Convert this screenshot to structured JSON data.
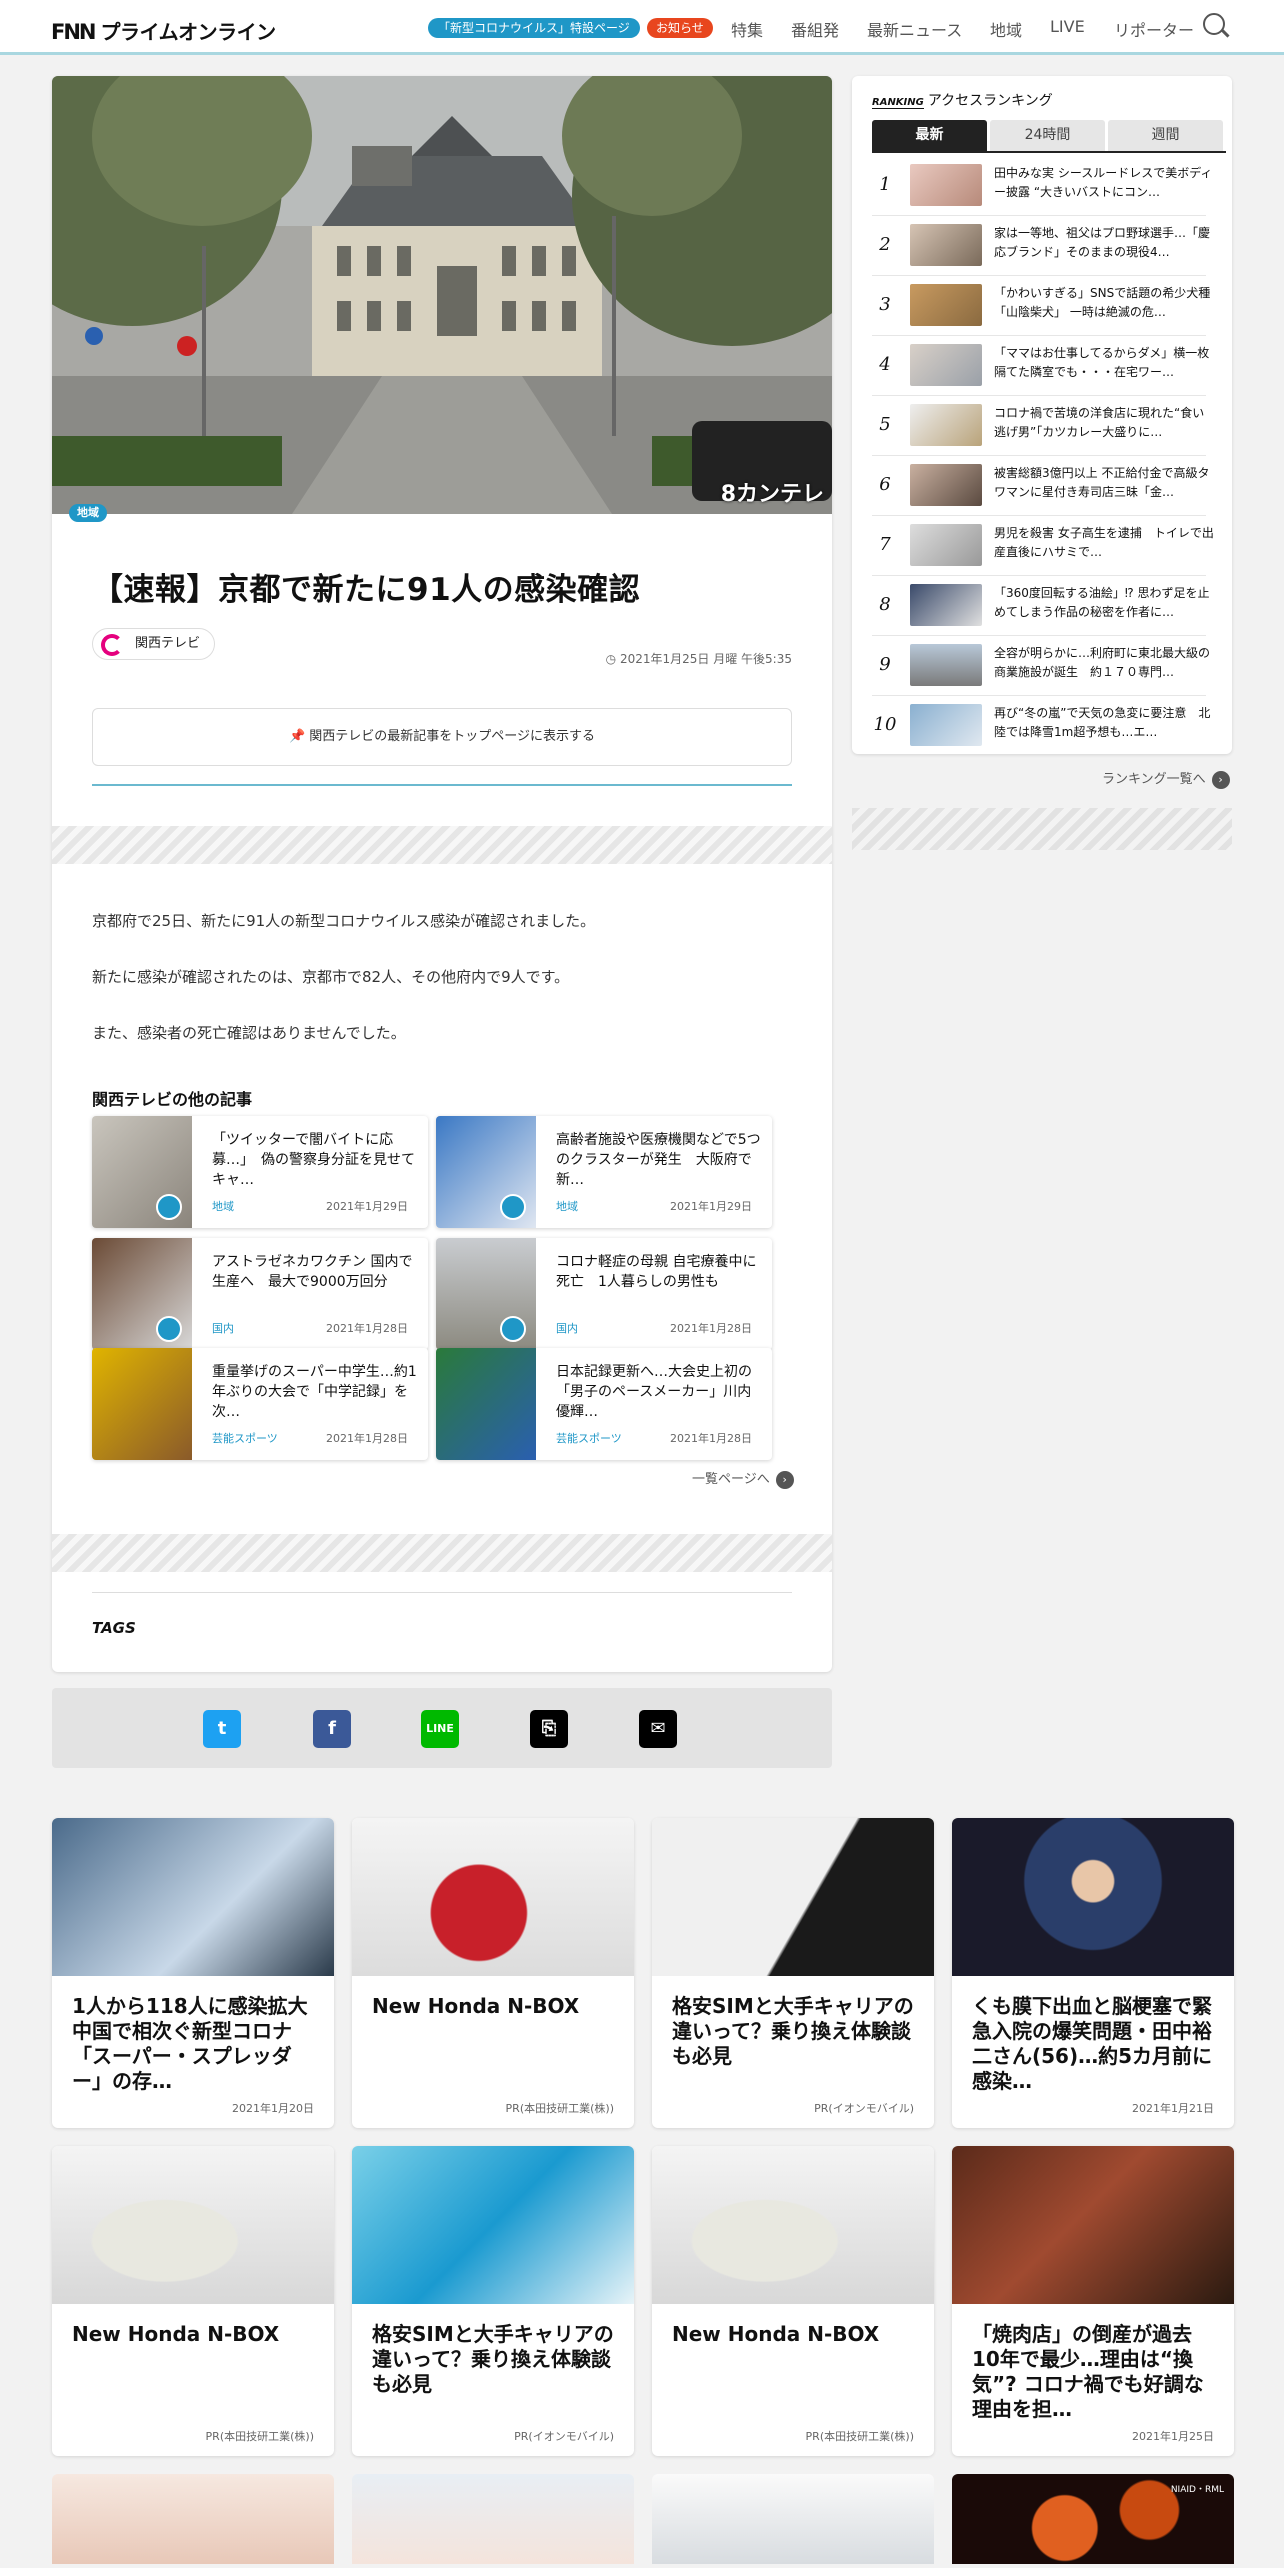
{
  "header": {
    "logo": "FNNプライムオンライン",
    "logo_mark": "FNN",
    "logo_text": "プライムオンライン",
    "covid_pill": "「新型コロナウイルス」特設ページ",
    "notice_pill": "お知らせ",
    "nav": [
      "特集",
      "番組発",
      "最新ニュース",
      "地域",
      "LIVE",
      "リポーター"
    ]
  },
  "article": {
    "region_badge": "地域",
    "title": "【速報】京都で新たに91人の感染確認",
    "source": "関西テレビ",
    "date": "2021年1月25日 月曜 午後5:35",
    "pin_text": "関西テレビの最新記事をトップページに表示する",
    "body": [
      "京都府で25日、新たに91人の新型コロナウイルス感染が確認されました。",
      "新たに感染が確認されたのは、京都市で82人、その他府内で9人です。",
      "また、感染者の死亡確認はありませんでした。"
    ],
    "other_heading": "関西テレビの他の記事",
    "other": [
      {
        "title": "「ツイッターで闇バイトに応募…」　偽の警察身分証を見せてキャ…",
        "cat": "地域",
        "date": "2021年1月29日"
      },
      {
        "title": "高齢者施設や医療機関などで5つのクラスターが発生　大阪府で新…",
        "cat": "地域",
        "date": "2021年1月29日"
      },
      {
        "title": "アストラゼネカワクチン 国内で生産へ　最大で9000万回分",
        "cat": "国内",
        "date": "2021年1月28日"
      },
      {
        "title": "コロナ軽症の母親 自宅療養中に死亡　1人暮らしの男性も",
        "cat": "国内",
        "date": "2021年1月28日"
      },
      {
        "title": "重量挙げのスーパー中学生…約1年ぶりの大会で「中学記録」を次…",
        "cat": "芸能スポーツ",
        "date": "2021年1月28日"
      },
      {
        "title": "日本記録更新へ…大会史上初の「男子のペースメーカー」川内優輝…",
        "cat": "芸能スポーツ",
        "date": "2021年1月28日"
      }
    ],
    "more_link": "一覧ページへ",
    "tags_label": "TAGS",
    "overlay_logo": "8カンテレ"
  },
  "share": {
    "icons": [
      "twitter-icon",
      "facebook-icon",
      "line-icon",
      "link-icon",
      "comment-icon"
    ]
  },
  "ranking": {
    "label_small": "RANKING",
    "label": "アクセスランキング",
    "tabs": [
      "最新",
      "24時間",
      "週間"
    ],
    "items": [
      {
        "n": "1",
        "title": "田中みな実 シースルードレスで美ボディー披露 “大きいバストにコン…"
      },
      {
        "n": "2",
        "title": "家は一等地、祖父はプロ野球選手…「慶応ブランド」そのままの現役4…"
      },
      {
        "n": "3",
        "title": "「かわいすぎる」SNSで話題の希少犬種「山陰柴犬」 一時は絶滅の危…"
      },
      {
        "n": "4",
        "title": "「ママはお仕事してるからダメ」横一枚隔てた隣室でも・・・在宅ワー…"
      },
      {
        "n": "5",
        "title": "コロナ禍で苦境の洋食店に現れた“食い逃げ男”「カツカレー大盛りに…"
      },
      {
        "n": "6",
        "title": "被害総額3億円以上 不正給付金で高級タワマンに星付き寿司店三昧「金…"
      },
      {
        "n": "7",
        "title": "男児を殺害 女子高生を逮捕　トイレで出産直後にハサミで…"
      },
      {
        "n": "8",
        "title": "「360度回転する油絵」⁉ 思わず足を止めてしまう作品の秘密を作者に…"
      },
      {
        "n": "9",
        "title": "全容が明らかに…利府町に東北最大級の商業施設が誕生　約１７０専門…"
      },
      {
        "n": "10",
        "title": "再び“冬の嵐”で天気の急変に要注意　北陸では降雪1m超予想も…エ…"
      }
    ],
    "more": "ランキング一覧へ"
  },
  "grid": [
    {
      "title": "1人から118人に感染拡大　中国で相次ぐ新型コロナ「スーパー・スプレッダー」の存…",
      "meta": "2021年1月20日"
    },
    {
      "title": "New Honda N-BOX",
      "meta": "PR(本田技研工業(株))"
    },
    {
      "title": "格安SIMと大手キャリアの違いって？乗り換え体験談も必見",
      "meta": "PR(イオンモバイル)"
    },
    {
      "title": "くも膜下出血と脳梗塞で緊急入院の爆笑問題・田中裕二さん(56)…約5カ月前に感染…",
      "meta": "2021年1月21日"
    },
    {
      "title": "New Honda N-BOX",
      "meta": "PR(本田技研工業(株))"
    },
    {
      "title": "格安SIMと大手キャリアの違いって？乗り換え体験談も必見",
      "meta": "PR(イオンモバイル)"
    },
    {
      "title": "New Honda N-BOX",
      "meta": "PR(本田技研工業(株))"
    },
    {
      "title": "「焼肉店」の倒産が過去10年で最少…理由は“換気”? コロナ禍でも好調な理由を担…",
      "meta": "2021年1月25日"
    }
  ],
  "bottom_overlay": "NIAID・RML"
}
